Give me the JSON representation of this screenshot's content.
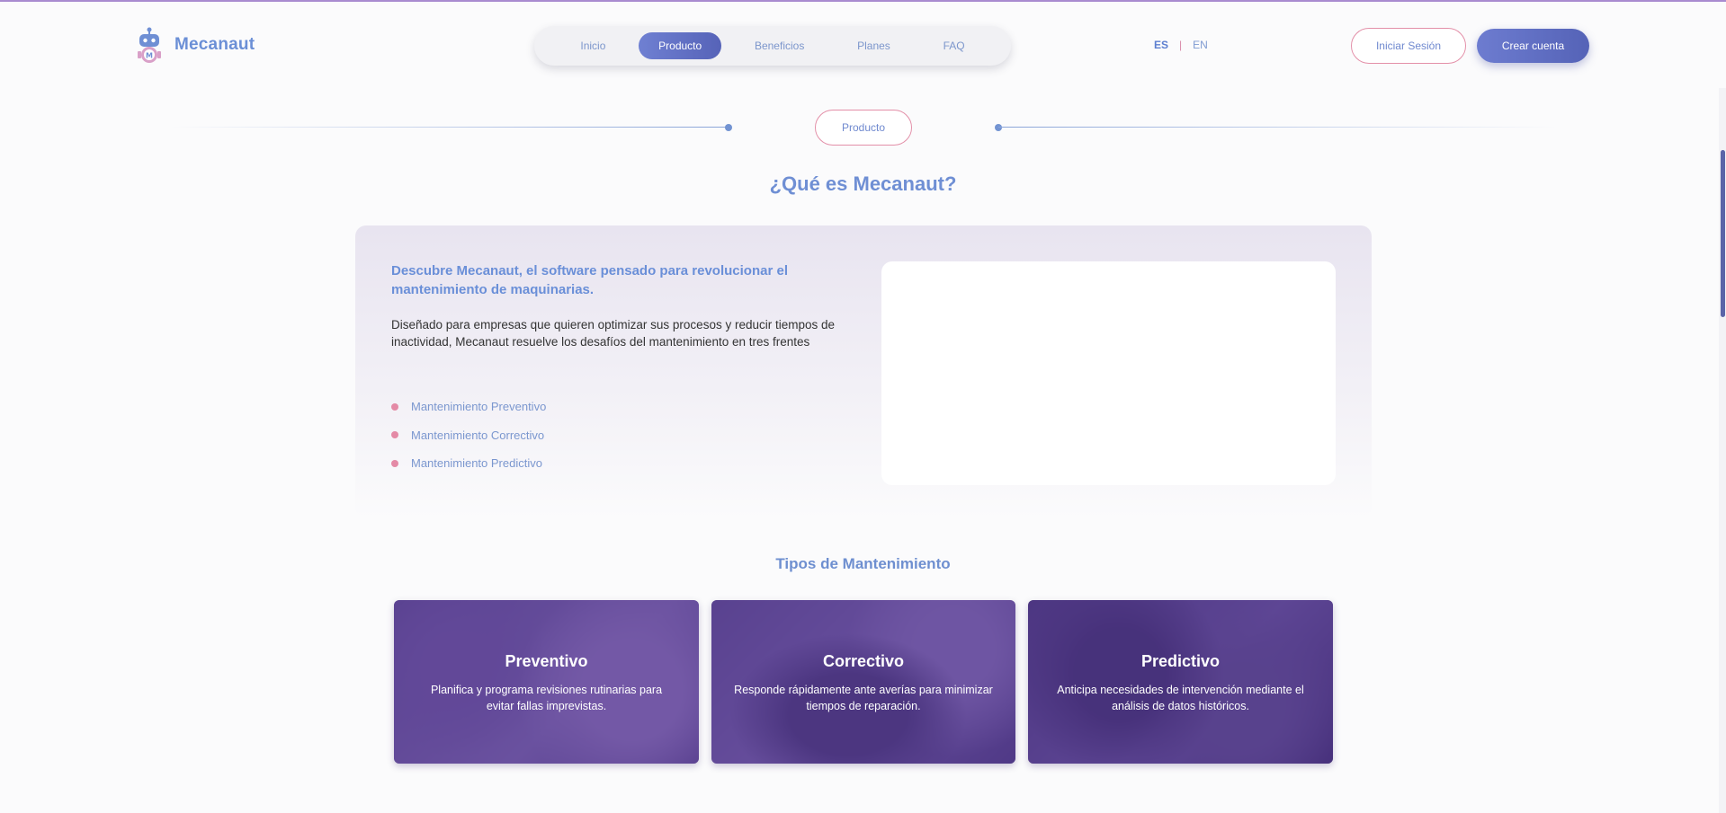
{
  "brand": {
    "name": "Mecanaut",
    "logo_icon": "robot-gear-icon"
  },
  "nav": {
    "items": [
      {
        "label": "Inicio",
        "active": false
      },
      {
        "label": "Producto",
        "active": true
      },
      {
        "label": "Beneficios",
        "active": false
      },
      {
        "label": "Planes",
        "active": false
      },
      {
        "label": "FAQ",
        "active": false
      }
    ]
  },
  "lang": {
    "es": "ES",
    "sep": "|",
    "en": "EN"
  },
  "auth": {
    "login": "Iniciar Sesión",
    "signup": "Crear cuenta"
  },
  "section": {
    "pill": "Producto",
    "title": "¿Qué es Mecanaut?",
    "headline": "Descubre Mecanaut, el software pensado para revolucionar el mantenimiento de maquinarias.",
    "body": "Diseñado para empresas que quieren optimizar sus procesos y reducir tiempos de inactividad, Mecanaut resuelve los desafíos del mantenimiento en tres frentes",
    "list": [
      "Mantenimiento Preventivo",
      "Mantenimiento Correctivo",
      "Mantenimiento Predictivo"
    ]
  },
  "types": {
    "title": "Tipos de Mantenimiento",
    "cards": [
      {
        "title": "Preventivo",
        "desc": "Planifica y programa revisiones rutinarias para evitar fallas imprevistas."
      },
      {
        "title": "Correctivo",
        "desc": "Responde rápidamente ante averías para minimizar tiempos de reparación."
      },
      {
        "title": "Predictivo",
        "desc": "Anticipa necesidades de intervención mediante el análisis de datos históricos."
      }
    ]
  },
  "colors": {
    "accent": "#5d6bbf",
    "pink": "#e38fa8",
    "link": "#6f8fd4"
  }
}
